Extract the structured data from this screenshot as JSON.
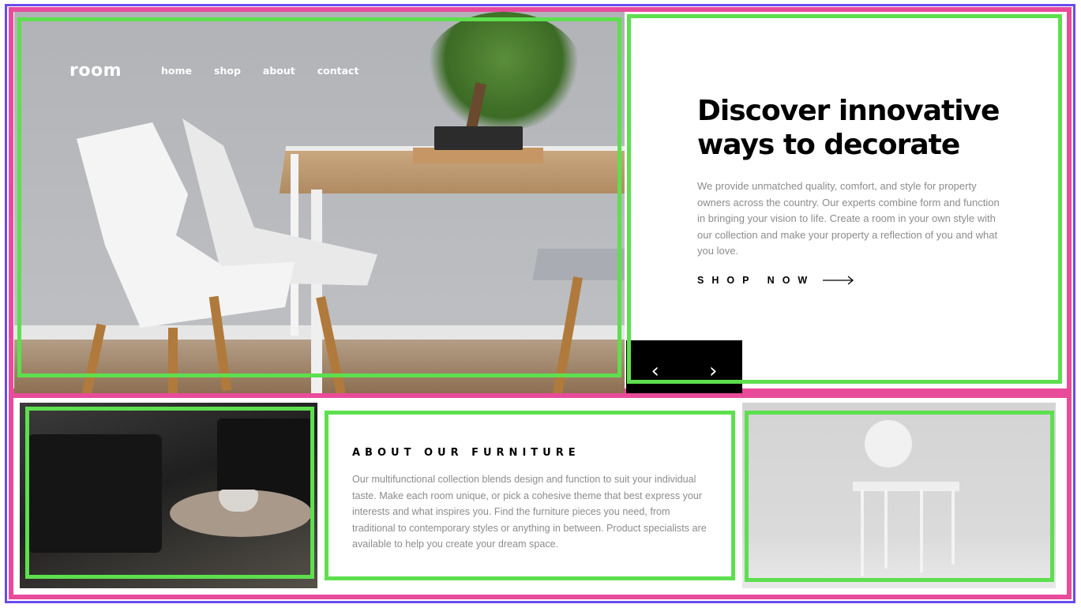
{
  "nav": {
    "logo": "room",
    "links": [
      "home",
      "shop",
      "about",
      "contact"
    ]
  },
  "hero": {
    "headline_line1": "Discover innovative",
    "headline_line2": "ways to decorate",
    "description": "We provide unmatched quality, comfort, and style for property owners across the country. Our experts combine form and function in bringing your vision to life. Create a room in your own style with our collection and make your property a reflection of you and what you love.",
    "cta_label": "SHOP NOW"
  },
  "slider": {
    "prev": "‹",
    "next": "›"
  },
  "about": {
    "title": "ABOUT OUR FURNITURE",
    "text": "Our multifunctional collection blends design and function to suit your individual taste. Make each room unique, or pick a cohesive theme that best express your interests and what inspires you. Find the furniture pieces you need, from traditional to contemporary styles or anything in between. Product specialists are available to help you create your dream space."
  },
  "colors": {
    "text_dark": "#000000",
    "text_muted": "#8c8c8c",
    "annotation_green": "#5ddf4e",
    "annotation_pink": "#e94b9b",
    "annotation_purple": "#6b4bef"
  }
}
